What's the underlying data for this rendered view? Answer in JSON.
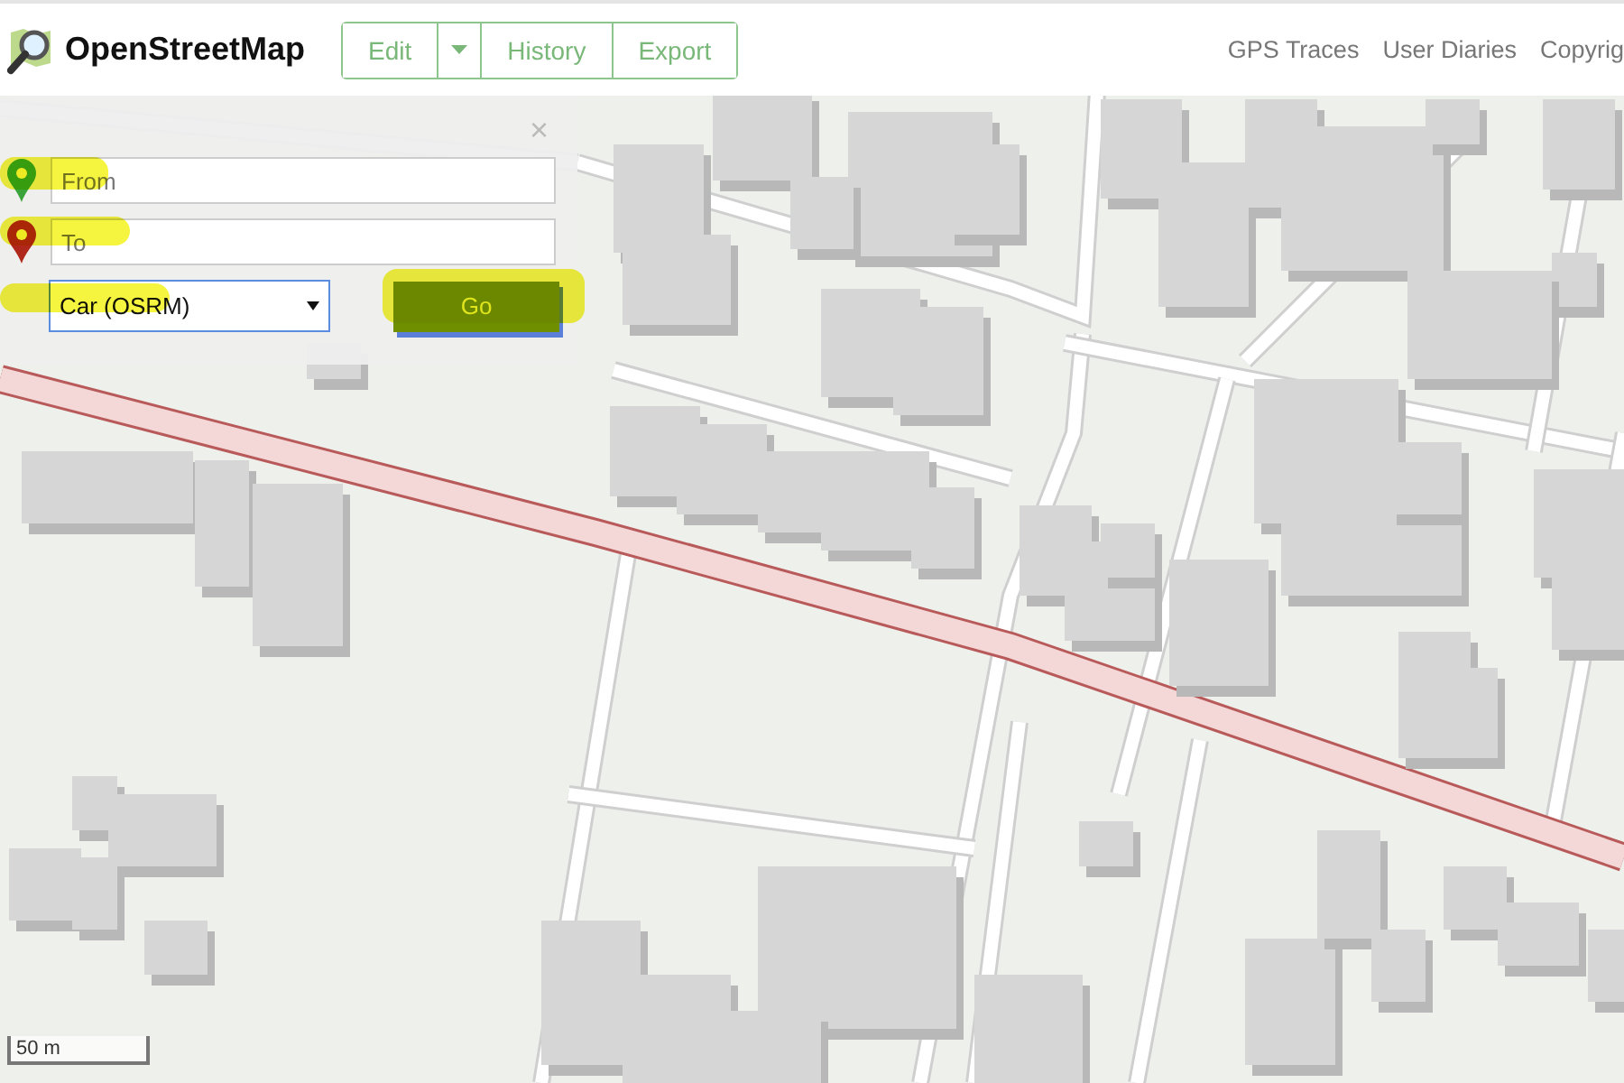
{
  "header": {
    "logo": "OpenStreetMap",
    "nav": [
      {
        "kind": "text",
        "label": "Edit"
      },
      {
        "kind": "caret"
      },
      {
        "kind": "text",
        "label": "History"
      },
      {
        "kind": "text",
        "label": "Export"
      }
    ],
    "links": [
      "GPS Traces",
      "User Diaries",
      "Copyrig"
    ]
  },
  "directions": {
    "close": "×",
    "from": {
      "placeholder": "From"
    },
    "to": {
      "placeholder": "To"
    },
    "mode": "Car (OSRM)",
    "go": "Go"
  },
  "scale": {
    "label": "50 m"
  }
}
